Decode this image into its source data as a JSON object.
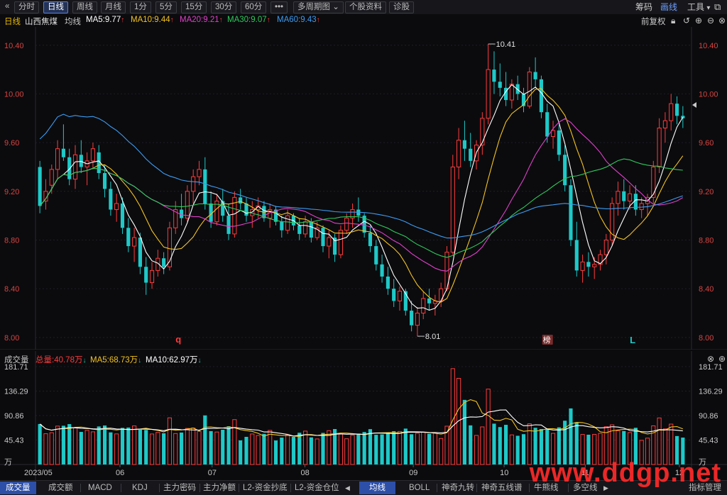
{
  "toolbar": {
    "back_icon": "double-chevron-left-icon",
    "periods": [
      "分时",
      "日线",
      "周线",
      "月线",
      "1分",
      "5分",
      "15分",
      "30分",
      "60分"
    ],
    "active_period": "日线",
    "more_label": "•••",
    "multi_period_label": "多周期图",
    "stock_info_label": "个股资料",
    "diagnose_label": "诊股",
    "right": {
      "chips": "筹码",
      "draw": "画线",
      "tools": "工具"
    }
  },
  "info": {
    "period": "日线",
    "stock_name": "山西焦煤",
    "ma_mode": "均线",
    "ma5": "MA5:9.77",
    "ma10": "MA10:9.44",
    "ma20": "MA20:9.21",
    "ma30": "MA30:9.07",
    "ma60": "MA60:9.43",
    "adjust": "前复权"
  },
  "colors": {
    "up": "#ff3b3b",
    "down": "#1ec9c8",
    "ma5": "#ffffff",
    "ma10": "#f4c320",
    "ma20": "#e040c8",
    "ma30": "#2ec95a",
    "ma60": "#3d9bf0"
  },
  "chart_data": [
    {
      "type": "candlestick",
      "ylim": [
        7.9,
        10.55
      ],
      "y_ticks": [
        "10.40",
        "10.00",
        "9.60",
        "9.20",
        "8.80",
        "8.40",
        "8.00"
      ],
      "x_ticks": [
        "2023/05",
        "06",
        "07",
        "08",
        "09",
        "10",
        "11",
        "12"
      ],
      "annotations": {
        "high": "10.41",
        "low": "8.01",
        "markers": [
          "q",
          "榜",
          "L"
        ]
      },
      "candles_ohlc": [
        [
          9.4,
          9.45,
          9.02,
          9.08
        ],
        [
          9.12,
          9.3,
          9.05,
          9.2
        ],
        [
          9.25,
          9.42,
          9.18,
          9.38
        ],
        [
          9.38,
          9.62,
          9.3,
          9.55
        ],
        [
          9.55,
          9.75,
          9.45,
          9.48
        ],
        [
          9.48,
          9.55,
          9.25,
          9.3
        ],
        [
          9.3,
          9.58,
          9.22,
          9.5
        ],
        [
          9.5,
          9.62,
          9.35,
          9.4
        ],
        [
          9.4,
          9.52,
          9.25,
          9.45
        ],
        [
          9.45,
          9.6,
          9.38,
          9.55
        ],
        [
          9.52,
          9.58,
          9.3,
          9.35
        ],
        [
          9.35,
          9.42,
          9.15,
          9.22
        ],
        [
          9.22,
          9.28,
          9.0,
          9.05
        ],
        [
          9.05,
          9.18,
          8.95,
          9.1
        ],
        [
          9.1,
          9.15,
          8.85,
          8.9
        ],
        [
          8.9,
          8.98,
          8.7,
          8.75
        ],
        [
          8.75,
          8.9,
          8.62,
          8.82
        ],
        [
          8.82,
          8.86,
          8.52,
          8.58
        ],
        [
          8.58,
          8.66,
          8.35,
          8.45
        ],
        [
          8.45,
          8.62,
          8.4,
          8.55
        ],
        [
          8.55,
          8.72,
          8.5,
          8.65
        ],
        [
          8.65,
          8.7,
          8.52,
          8.58
        ],
        [
          8.58,
          8.95,
          8.55,
          8.9
        ],
        [
          8.9,
          9.12,
          8.85,
          9.05
        ],
        [
          9.05,
          9.18,
          8.92,
          8.98
        ],
        [
          8.98,
          9.25,
          8.95,
          9.2
        ],
        [
          9.2,
          9.38,
          9.1,
          9.32
        ],
        [
          9.32,
          9.45,
          9.25,
          9.38
        ],
        [
          9.38,
          9.48,
          9.05,
          9.1
        ],
        [
          9.1,
          9.2,
          8.9,
          8.95
        ],
        [
          8.95,
          9.18,
          8.92,
          9.12
        ],
        [
          9.12,
          9.22,
          8.95,
          9.0
        ],
        [
          9.0,
          9.1,
          8.8,
          8.85
        ],
        [
          8.85,
          9.2,
          8.82,
          9.15
        ],
        [
          9.15,
          9.22,
          9.05,
          9.1
        ],
        [
          9.1,
          9.15,
          8.95,
          9.0
        ],
        [
          9.0,
          9.12,
          8.9,
          9.05
        ],
        [
          9.05,
          9.15,
          8.98,
          9.08
        ],
        [
          9.08,
          9.12,
          8.95,
          8.98
        ],
        [
          8.98,
          9.1,
          8.9,
          9.05
        ],
        [
          9.05,
          9.08,
          8.92,
          8.95
        ],
        [
          8.95,
          9.0,
          8.82,
          8.88
        ],
        [
          8.88,
          9.05,
          8.85,
          9.0
        ],
        [
          9.0,
          9.02,
          8.88,
          8.92
        ],
        [
          8.92,
          8.98,
          8.8,
          8.85
        ],
        [
          8.85,
          9.0,
          8.82,
          8.95
        ],
        [
          8.95,
          8.98,
          8.78,
          8.82
        ],
        [
          8.82,
          8.95,
          8.8,
          8.9
        ],
        [
          8.9,
          8.92,
          8.7,
          8.75
        ],
        [
          8.75,
          8.88,
          8.65,
          8.82
        ],
        [
          8.82,
          8.85,
          8.62,
          8.68
        ],
        [
          8.68,
          8.92,
          8.65,
          8.88
        ],
        [
          8.88,
          9.02,
          8.85,
          8.98
        ],
        [
          8.98,
          9.1,
          8.9,
          9.05
        ],
        [
          9.05,
          9.15,
          8.95,
          9.0
        ],
        [
          9.0,
          9.02,
          8.82,
          8.86
        ],
        [
          8.86,
          8.92,
          8.7,
          8.75
        ],
        [
          8.75,
          8.8,
          8.55,
          8.6
        ],
        [
          8.6,
          8.68,
          8.45,
          8.5
        ],
        [
          8.5,
          8.58,
          8.35,
          8.4
        ],
        [
          8.4,
          8.48,
          8.25,
          8.3
        ],
        [
          8.3,
          8.42,
          8.22,
          8.38
        ],
        [
          8.38,
          8.4,
          8.18,
          8.22
        ],
        [
          8.22,
          8.3,
          8.05,
          8.1
        ],
        [
          8.1,
          8.25,
          8.01,
          8.2
        ],
        [
          8.2,
          8.38,
          8.15,
          8.32
        ],
        [
          8.32,
          8.4,
          8.22,
          8.28
        ],
        [
          8.28,
          8.35,
          8.18,
          8.3
        ],
        [
          8.3,
          8.45,
          8.25,
          8.4
        ],
        [
          8.4,
          8.75,
          8.38,
          8.7
        ],
        [
          8.7,
          9.5,
          8.68,
          9.4
        ],
        [
          9.4,
          9.72,
          9.3,
          9.62
        ],
        [
          9.62,
          9.78,
          9.45,
          9.55
        ],
        [
          9.55,
          9.68,
          9.4,
          9.45
        ],
        [
          9.45,
          9.62,
          9.38,
          9.58
        ],
        [
          9.58,
          9.85,
          9.5,
          9.8
        ],
        [
          9.8,
          10.41,
          9.75,
          10.2
        ],
        [
          10.2,
          10.35,
          10.0,
          10.1
        ],
        [
          10.1,
          10.25,
          9.98,
          10.05
        ],
        [
          10.05,
          10.18,
          9.9,
          9.95
        ],
        [
          9.95,
          10.12,
          9.88,
          10.08
        ],
        [
          10.08,
          10.15,
          9.95,
          10.0
        ],
        [
          10.0,
          10.05,
          9.85,
          9.9
        ],
        [
          9.9,
          10.22,
          9.88,
          10.18
        ],
        [
          10.18,
          10.3,
          10.05,
          10.12
        ],
        [
          10.12,
          10.15,
          9.8,
          9.85
        ],
        [
          9.85,
          9.92,
          9.6,
          9.65
        ],
        [
          9.65,
          9.78,
          9.55,
          9.7
        ],
        [
          9.7,
          9.75,
          9.45,
          9.5
        ],
        [
          9.5,
          9.58,
          9.2,
          9.25
        ],
        [
          9.25,
          9.3,
          8.75,
          8.8
        ],
        [
          8.8,
          8.95,
          8.5,
          8.55
        ],
        [
          8.55,
          8.68,
          8.45,
          8.62
        ],
        [
          8.62,
          8.7,
          8.5,
          8.58
        ],
        [
          8.58,
          8.66,
          8.48,
          8.6
        ],
        [
          8.6,
          8.72,
          8.55,
          8.68
        ],
        [
          8.68,
          8.85,
          8.6,
          8.8
        ],
        [
          8.8,
          9.15,
          8.75,
          9.1
        ],
        [
          9.1,
          9.28,
          9.0,
          9.2
        ],
        [
          9.2,
          9.3,
          9.05,
          9.12
        ],
        [
          9.12,
          9.25,
          9.05,
          9.18
        ],
        [
          9.18,
          9.25,
          9.0,
          9.05
        ],
        [
          9.05,
          9.15,
          8.98,
          9.1
        ],
        [
          9.1,
          9.18,
          9.0,
          9.15
        ],
        [
          9.15,
          9.45,
          9.1,
          9.4
        ],
        [
          9.4,
          9.8,
          9.35,
          9.72
        ],
        [
          9.72,
          9.85,
          9.6,
          9.78
        ],
        [
          9.78,
          10.0,
          9.7,
          9.92
        ],
        [
          9.92,
          9.98,
          9.75,
          9.82
        ],
        [
          9.82,
          9.9,
          9.72,
          9.8
        ]
      ]
    },
    {
      "type": "bar",
      "title": "成交量",
      "legend": {
        "total": "总量:40.78万",
        "ma5": "MA5:68.73万",
        "ma10": "MA10:62.97万"
      },
      "y_ticks": [
        "181.71",
        "136.29",
        "90.86",
        "45.43"
      ],
      "unit": "万",
      "ylim": [
        0,
        181.71
      ]
    }
  ],
  "bottom_tabs": {
    "left": [
      "成交量",
      "成交额",
      "MACD",
      "KDJ",
      "主力密码",
      "主力净额",
      "L2-资金抄底",
      "L2-资金仓位"
    ],
    "right": [
      "均线",
      "BOLL",
      "神奇九转",
      "神奇五线谱",
      "牛熊线",
      "多空线"
    ],
    "settings": "指标管理"
  },
  "watermark": "www.ddgp.net"
}
